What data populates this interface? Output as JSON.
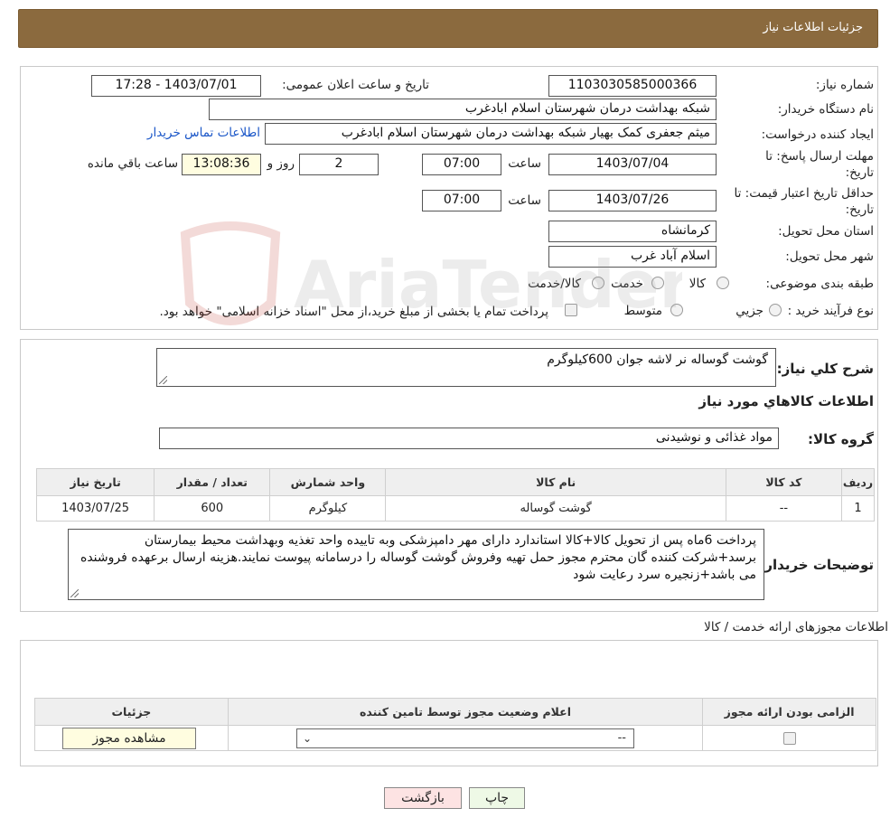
{
  "header": {
    "title": "جزئیات اطلاعات نیاز"
  },
  "info": {
    "need_number_label": "شماره نیاز:",
    "need_number": "1103030585000366",
    "announce_label": "تاریخ و ساعت اعلان عمومی:",
    "announce_value": "1403/07/01 - 17:28",
    "buyer_org_label": "نام دستگاه خریدار:",
    "buyer_org": "شبکه بهداشت درمان شهرستان اسلام ابادغرب",
    "requester_label": "ایجاد کننده درخواست:",
    "requester": "میثم جعفری کمک بهیار شبکه بهداشت درمان شهرستان اسلام ابادغرب",
    "contact_link": "اطلاعات تماس خریدار",
    "deadline_label_1": "مهلت ارسال پاسخ: تا",
    "deadline_label_2": "تاریخ:",
    "deadline_date": "1403/07/04",
    "time_label": "ساعت",
    "deadline_time": "07:00",
    "days_value": "2",
    "days_label": "روز و",
    "remaining_time": "13:08:36",
    "remaining_label": "ساعت باقي مانده",
    "validity_label_1": "حداقل تاریخ اعتبار قیمت: تا",
    "validity_label_2": "تاریخ:",
    "validity_date": "1403/07/26",
    "validity_time_label": "ساعت",
    "validity_time": "07:00",
    "province_label": "استان محل تحویل:",
    "province": "کرمانشاه",
    "city_label": "شهر محل تحویل:",
    "city": "اسلام آباد غرب",
    "category_label": "طبقه بندی موضوعی:",
    "category_options": [
      "کالا",
      "خدمت",
      "کالا/خدمت"
    ],
    "process_label": "نوع فرآیند خرید :",
    "process_options": [
      "جزیي",
      "متوسط"
    ],
    "payment_note": "پرداخت تمام یا بخشی از مبلغ خرید،از محل \"اسناد خزانه اسلامی\" خواهد بود."
  },
  "details": {
    "summary_label": "شرح کلي نیاز:",
    "summary": "گوشت گوساله نر لاشه جوان 600کیلوگرم",
    "goods_info_title": "اطلاعات کالاهاي مورد نیاز",
    "goods_group_label": "گروه کالا:",
    "goods_group": "مواد غذائی و نوشیدنی",
    "table": {
      "headers": [
        "ردیف",
        "کد کالا",
        "نام کالا",
        "واحد شمارش",
        "تعداد / مقدار",
        "تاریخ نیاز"
      ],
      "rows": [
        [
          "1",
          "--",
          "گوشت گوساله",
          "کیلوگرم",
          "600",
          "1403/07/25"
        ]
      ]
    },
    "buyer_notes_label": "توضیحات خریدار:",
    "buyer_notes": "پرداخت 6ماه پس از تحویل کالا+کالا استاندارد دارای مهر دامپزشکی  وبه تاییده واحد تغذیه وبهداشت محیط بیمارستان برسد+شرکت کننده گان محترم مجوز حمل تهیه وفروش گوشت گوساله  را درسامانه پیوست نمایند.هزینه ارسال برعهده فروشنده می باشد+زنجیره سرد رعایت شود"
  },
  "permits": {
    "section_title": "اطلاعات مجوزهای ارائه خدمت / کالا",
    "headers": [
      "الزامی بودن ارائه مجوز",
      "اعلام وضعیت مجوز توسط تامین کننده",
      "جزئیات"
    ],
    "select_value": "--",
    "view_button": "مشاهده مجوز"
  },
  "footer": {
    "print_button": "چاپ",
    "back_button": "بازگشت"
  },
  "watermark_text": "AriaTender.net",
  "colors": {
    "header_bg": "#8b6a3e",
    "link": "#1a56c8",
    "back_button_bg": "#fde3e3",
    "print_button_bg": "#eef9e6",
    "yellow_field": "#fffde0"
  }
}
